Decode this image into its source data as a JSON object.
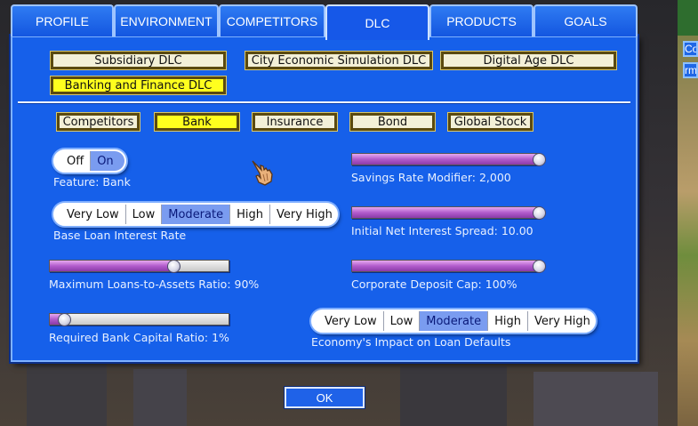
{
  "tabs": [
    {
      "label": "PROFILE",
      "active": false
    },
    {
      "label": "ENVIRONMENT",
      "active": false
    },
    {
      "label": "COMPETITORS",
      "active": false
    },
    {
      "label": "DLC",
      "active": true
    },
    {
      "label": "PRODUCTS",
      "active": false
    },
    {
      "label": "GOALS",
      "active": false
    }
  ],
  "dlc_buttons": [
    {
      "label": "Subsidiary DLC",
      "selected": false
    },
    {
      "label": "City Economic Simulation DLC",
      "selected": false
    },
    {
      "label": "Digital Age DLC",
      "selected": false
    },
    {
      "label": "Banking and Finance DLC",
      "selected": true
    }
  ],
  "sub_buttons": [
    {
      "label": "Competitors",
      "selected": false
    },
    {
      "label": "Bank",
      "selected": true
    },
    {
      "label": "Insurance",
      "selected": false
    },
    {
      "label": "Bond",
      "selected": false
    },
    {
      "label": "Global Stock",
      "selected": false
    }
  ],
  "feature_bank": {
    "options": [
      "Off",
      "On"
    ],
    "selected": "On",
    "label": "Feature: Bank"
  },
  "base_loan_interest_rate": {
    "options": [
      "Very Low",
      "Low",
      "Moderate",
      "High",
      "Very High"
    ],
    "selected": "Moderate",
    "label": "Base Loan Interest Rate"
  },
  "max_loans_to_assets": {
    "label": "Maximum Loans-to-Assets Ratio:",
    "value_text": "90%",
    "level": 0.69
  },
  "required_capital_ratio": {
    "label": "Required Bank Capital Ratio:",
    "value_text": "1%",
    "level": 0.08
  },
  "savings_rate_modifier": {
    "label": "Savings Rate Modifier:",
    "value_text": "2,000",
    "level": 1.0
  },
  "initial_net_interest_spread": {
    "label": "Initial Net Interest Spread:",
    "value_text": "10.00",
    "level": 1.0
  },
  "corporate_deposit_cap": {
    "label": "Corporate Deposit Cap:",
    "value_text": "100%",
    "level": 1.0
  },
  "economy_impact_loan_defaults": {
    "options": [
      "Very Low",
      "Low",
      "Moderate",
      "High",
      "Very High"
    ],
    "selected": "Moderate",
    "label": "Economy's Impact on Loan Defaults"
  },
  "ok_label": "OK",
  "side_buttons": [
    "Co",
    "rm"
  ],
  "colors": {
    "panel": "#1660ea",
    "selected_yellow": "#ffff1e",
    "slider_fill": "#b25ccc",
    "segment_selected": "#7a9cf0"
  }
}
